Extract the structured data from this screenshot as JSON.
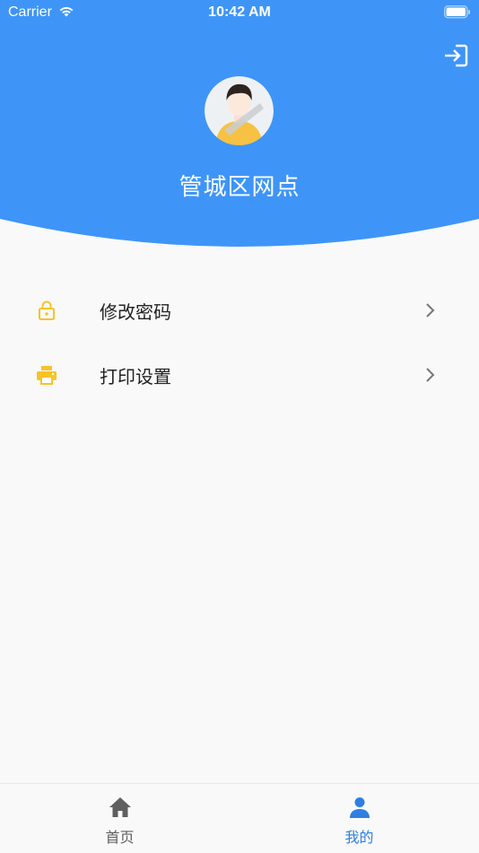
{
  "status_bar": {
    "carrier": "Carrier",
    "time": "10:42 AM"
  },
  "profile": {
    "name": "管城区网点"
  },
  "menu": {
    "items": [
      {
        "label": "修改密码",
        "icon": "lock-icon"
      },
      {
        "label": "打印设置",
        "icon": "printer-icon"
      }
    ]
  },
  "tabbar": {
    "tabs": [
      {
        "label": "首页",
        "icon": "home-icon",
        "active": false
      },
      {
        "label": "我的",
        "icon": "person-icon",
        "active": true
      }
    ]
  },
  "colors": {
    "header_blue": "#3e95f7",
    "accent_yellow": "#f8c327",
    "active_tab": "#2f7fe0",
    "inactive_tab": "#5f5f5f"
  }
}
